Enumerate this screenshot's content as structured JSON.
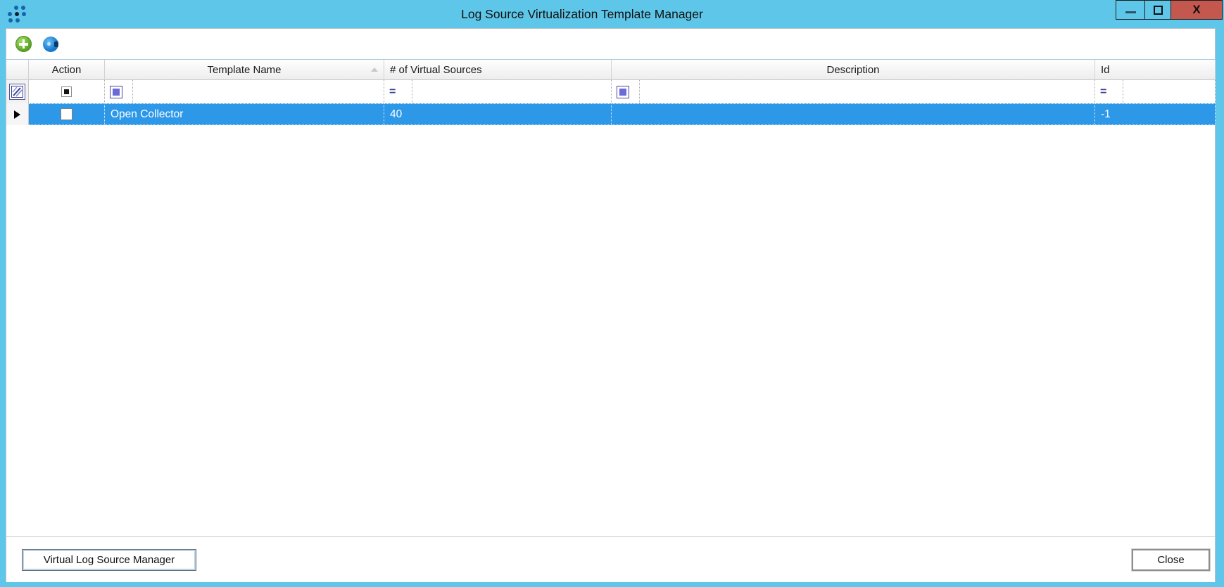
{
  "window": {
    "title": "Log Source Virtualization Template Manager",
    "close_glyph": "X"
  },
  "toolbar": {
    "icons": [
      "add-icon",
      "refresh-icon"
    ]
  },
  "grid": {
    "columns": [
      {
        "id": "action",
        "label": "Action"
      },
      {
        "id": "template_name",
        "label": "Template Name",
        "sort": "ascending"
      },
      {
        "id": "virtual_sources",
        "label": "# of Virtual Sources"
      },
      {
        "id": "description",
        "label": "Description"
      },
      {
        "id": "id",
        "label": "Id"
      }
    ],
    "filter_row": {
      "selector_icon": "filter-icon",
      "action_state": "indeterminate",
      "template_name_state": "checked",
      "virtual_sources_operator": "=",
      "description_state": "checked",
      "id_operator": "="
    },
    "rows": [
      {
        "selected": true,
        "action_checked": false,
        "template_name": "Open Collector",
        "virtual_sources": "40",
        "description": "",
        "id": "-1"
      }
    ]
  },
  "footer": {
    "manager_button_label": "Virtual Log Source Manager",
    "close_button_label": "Close"
  },
  "colors": {
    "titlebar": "#5ec7e9",
    "selection": "#2d97e8",
    "close_button": "#c4584e",
    "add_icon_green": "#63ad28",
    "filter_accent": "#3c3c94",
    "checkbox_fill": "#6a6ad8"
  }
}
